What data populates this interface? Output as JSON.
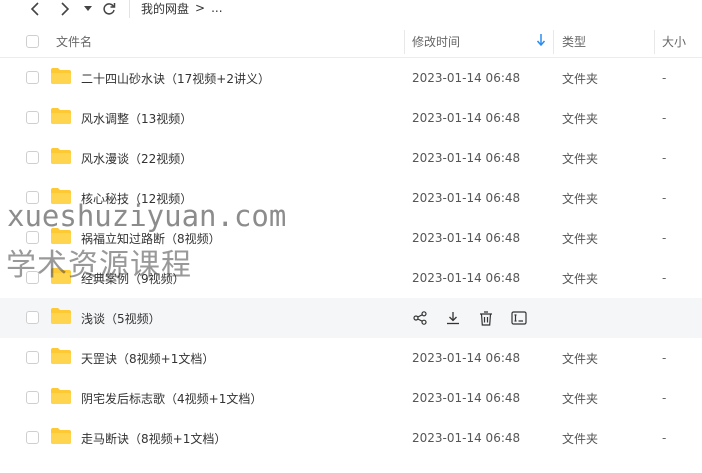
{
  "toolbar": {
    "breadcrumb_root": "我的网盘",
    "breadcrumb_sep": ">",
    "breadcrumb_more": "..."
  },
  "header": {
    "name": "文件名",
    "mtime": "修改时间",
    "type": "类型",
    "size": "大小"
  },
  "rows": [
    {
      "name": "二十四山砂水诀（17视频+2讲义）",
      "mtime": "2023-01-14 06:48",
      "type": "文件夹",
      "size": "-"
    },
    {
      "name": "风水调整（13视频）",
      "mtime": "2023-01-14 06:48",
      "type": "文件夹",
      "size": "-"
    },
    {
      "name": "风水漫谈（22视频）",
      "mtime": "2023-01-14 06:48",
      "type": "文件夹",
      "size": "-"
    },
    {
      "name": "核心秘技（12视频）",
      "mtime": "2023-01-14 06:48",
      "type": "文件夹",
      "size": "-"
    },
    {
      "name": "祸福立知过路断（8视频）",
      "mtime": "2023-01-14 06:48",
      "type": "文件夹",
      "size": "-"
    },
    {
      "name": "经典案例（9视频）",
      "mtime": "2023-01-14 06:48",
      "type": "文件夹",
      "size": "-"
    },
    {
      "name": "浅谈（5视频）",
      "mtime": "",
      "type": "",
      "size": ""
    },
    {
      "name": "天罡诀（8视频+1文档）",
      "mtime": "2023-01-14 06:48",
      "type": "文件夹",
      "size": "-"
    },
    {
      "name": "阴宅发后标志歌（4视频+1文档）",
      "mtime": "2023-01-14 06:48",
      "type": "文件夹",
      "size": "-"
    },
    {
      "name": "走马断诀（8视频+1文档）",
      "mtime": "2023-01-14 06:48",
      "type": "文件夹",
      "size": "-"
    }
  ],
  "icons": {
    "back": "chevron-left-icon",
    "forward": "chevron-right-icon",
    "history": "caret-down-icon",
    "refresh": "refresh-icon",
    "sort": "arrow-down-icon",
    "folder": "folder-icon",
    "share": "share-icon",
    "download": "download-icon",
    "delete": "trash-icon",
    "more": "rename-icon"
  },
  "colors": {
    "folder": "#FFC933",
    "sort_accent": "#2b8cf0",
    "hover_row": "#f5f6f8"
  },
  "watermark": {
    "line1": "xueshuziyuan.com",
    "line2": "学术资源课程"
  }
}
